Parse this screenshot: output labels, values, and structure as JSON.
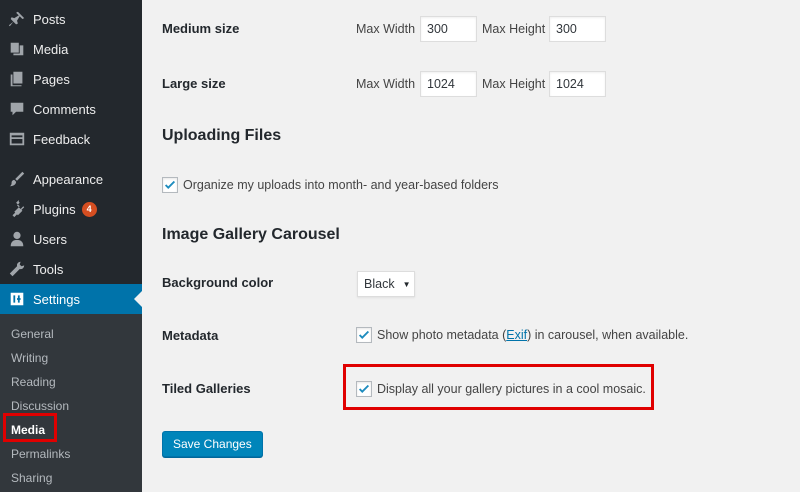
{
  "sidebar": {
    "items": [
      {
        "label": "Posts",
        "icon": "pin-icon"
      },
      {
        "label": "Media",
        "icon": "media-icon"
      },
      {
        "label": "Pages",
        "icon": "pages-icon"
      },
      {
        "label": "Comments",
        "icon": "comment-icon"
      },
      {
        "label": "Feedback",
        "icon": "feedback-icon"
      },
      {
        "label": "Appearance",
        "icon": "brush-icon"
      },
      {
        "label": "Plugins",
        "icon": "plug-icon",
        "badge": "4"
      },
      {
        "label": "Users",
        "icon": "user-icon"
      },
      {
        "label": "Tools",
        "icon": "wrench-icon"
      },
      {
        "label": "Settings",
        "icon": "settings-icon",
        "active": true
      }
    ],
    "submenu": [
      "General",
      "Writing",
      "Reading",
      "Discussion",
      "Media",
      "Permalinks",
      "Sharing"
    ],
    "submenu_current": "Media"
  },
  "main": {
    "medium": {
      "label": "Medium size",
      "max_width_label": "Max Width",
      "max_width": "300",
      "max_height_label": "Max Height",
      "max_height": "300"
    },
    "large": {
      "label": "Large size",
      "max_width_label": "Max Width",
      "max_width": "1024",
      "max_height_label": "Max Height",
      "max_height": "1024"
    },
    "uploading": {
      "title": "Uploading Files",
      "organize_label": "Organize my uploads into month- and year-based folders",
      "organize_checked": true
    },
    "carousel": {
      "title": "Image Gallery Carousel",
      "bg_label": "Background color",
      "bg_value": "Black",
      "metadata_label": "Metadata",
      "metadata_text_before": "Show photo metadata (",
      "metadata_link": "Exif",
      "metadata_text_after": ") in carousel, when available.",
      "metadata_checked": true,
      "tiled_label": "Tiled Galleries",
      "tiled_text": "Display all your gallery pictures in a cool mosaic.",
      "tiled_checked": true
    },
    "save_label": "Save Changes"
  },
  "colors": {
    "sidebar_bg": "#23282d",
    "active_bg": "#0073aa",
    "highlight": "#e00000",
    "button": "#0085ba"
  }
}
